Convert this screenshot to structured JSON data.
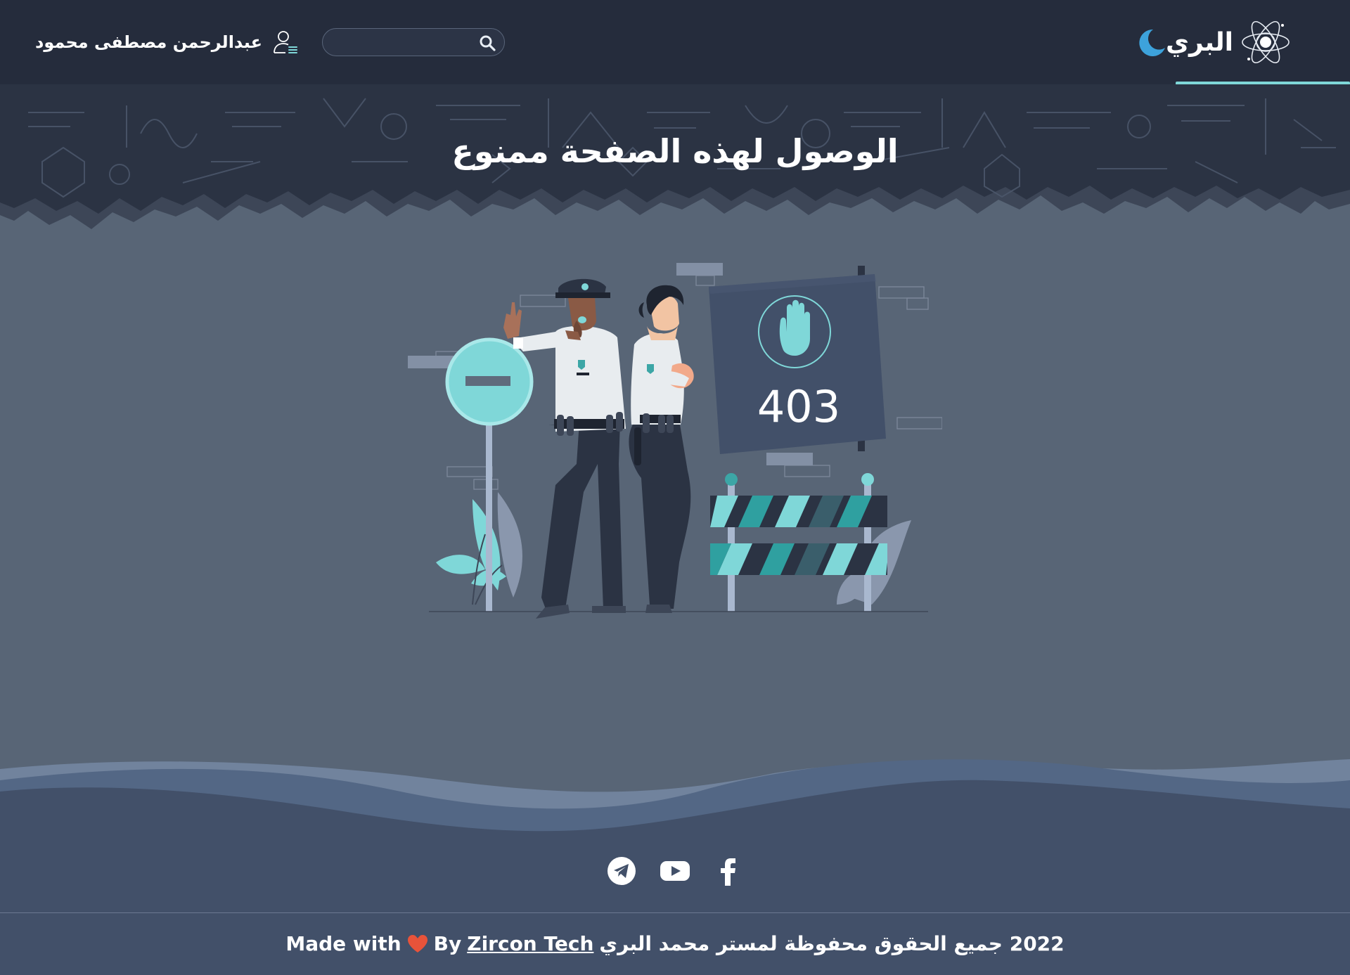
{
  "header": {
    "brand_name": "البري",
    "search_placeholder": "",
    "user_name": "عبدالرحمن مصطفى محمود"
  },
  "main": {
    "title": "الوصول لهذه الصفحة ممنوع",
    "error_code": "403"
  },
  "footer": {
    "social_links": [
      "telegram-icon",
      "youtube-icon",
      "facebook-icon"
    ],
    "made_with_text": "Made with",
    "by_text": "By",
    "company_link": "Zircon Tech",
    "copyright_text": "2022 جميع الحقوق محفوظة لمستر محمد البري"
  },
  "colors": {
    "header_bg": "#252c3c",
    "page_bg": "#586576",
    "accent": "#7fd7d8",
    "footer_bg": "#425069",
    "heart": "#e8533a",
    "moon": "#3da2db"
  }
}
